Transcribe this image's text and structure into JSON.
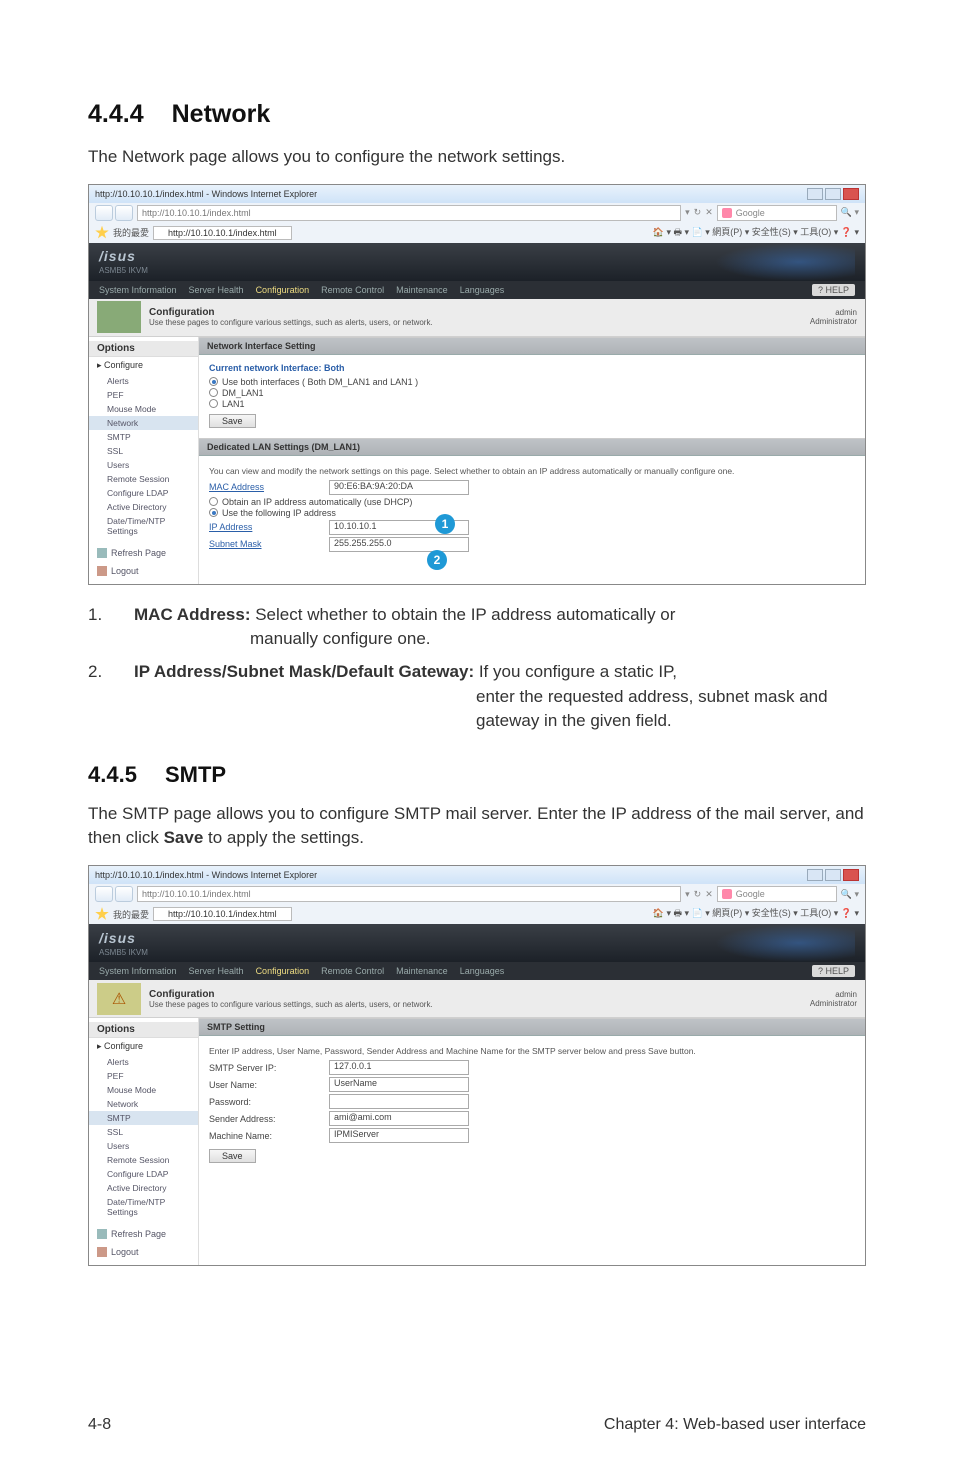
{
  "section1": {
    "number": "4.4.4",
    "title": "Network",
    "intro": "The Network page allows you to configure the network settings."
  },
  "section2": {
    "number": "4.4.5",
    "title": "SMTP",
    "intro1": "The SMTP page allows you to configure SMTP mail server. Enter the IP address of the mail server, and then click ",
    "intro_bold": "Save",
    "intro2": " to apply the settings."
  },
  "list1": {
    "n1": "1.",
    "term1": "MAC Address:",
    "desc1": " Select whether to obtain the IP address automatically or",
    "desc1b": "manually configure one.",
    "n2": "2.",
    "term2": "IP Address/Subnet Mask/Default Gateway:",
    "desc2": " If you configure a static IP,",
    "desc2b": "enter the requested address, subnet mask and gateway in the given field."
  },
  "browser": {
    "title": "http://10.10.10.1/index.html - Windows Internet Explorer",
    "url_input": "http://10.10.10.1/index.html",
    "search_placeholder": "Google",
    "fav_label": "我的最愛",
    "tab": "http://10.10.10.1/index.html",
    "toolbar": "🏠 ▾ 🖶 ▾ 📄 ▾ 網頁(P) ▾ 安全性(S) ▾ 工具(O) ▾ ❓ ▾"
  },
  "kvm": {
    "logo": "/isus",
    "sublogo": "ASMB5 IKVM",
    "help": "? HELP",
    "nav": {
      "i1": "System Information",
      "i2": "Server Health",
      "i3": "Configuration",
      "i4": "Remote Control",
      "i5": "Maintenance",
      "i6": "Languages"
    },
    "config_hd": "Configuration",
    "config_sub": "Use these pages to configure various settings, such as alerts, users, or network.",
    "user": "admin",
    "role": "Administrator",
    "options_hd": "Options",
    "cat": "Configure",
    "sidebar": {
      "alerts": "Alerts",
      "pef": "PEF",
      "mouse": "Mouse Mode",
      "network": "Network",
      "smtp": "SMTP",
      "ssl": "SSL",
      "users": "Users",
      "remote": "Remote Session",
      "ldap": "Configure LDAP",
      "ad": "Active Directory",
      "ntp": "Date/Time/NTP Settings"
    },
    "refresh": "Refresh Page",
    "logout": "Logout"
  },
  "net": {
    "hd1": "Network Interface Setting",
    "current": "Current network Interface: Both",
    "r1": "Use both interfaces ( Both DM_LAN1 and LAN1 )",
    "r2": "DM_LAN1",
    "r3": "LAN1",
    "save": "Save",
    "hd2": "Dedicated LAN Settings (DM_LAN1)",
    "hint": "You can view and modify the network settings on this page. Select whether to obtain an IP address automatically or manually configure one.",
    "mac_lab": "MAC Address",
    "mac_val": "90:E6:BA:9A:20:DA",
    "r4": "Obtain an IP address automatically (use DHCP)",
    "r5": "Use the following IP address",
    "ip_lab": "IP Address",
    "ip_val": "10.10.10.1",
    "sm_lab": "Subnet Mask",
    "sm_val": "255.255.255.0"
  },
  "smtp": {
    "hd": "SMTP Setting",
    "hint": "Enter IP address, User Name, Password, Sender Address and Machine Name for the SMTP server below and press Save button.",
    "l1": "SMTP Server IP:",
    "v1": "127.0.0.1",
    "l2": "User Name:",
    "v2": "UserName",
    "l3": "Password:",
    "l4": "Sender Address:",
    "v4": "ami@ami.com",
    "l5": "Machine Name:",
    "v5": "IPMIServer",
    "save": "Save"
  },
  "callouts": {
    "c1": "1",
    "c2": "2"
  },
  "footer": {
    "left": "4-8",
    "right": "Chapter 4: Web-based user interface"
  }
}
